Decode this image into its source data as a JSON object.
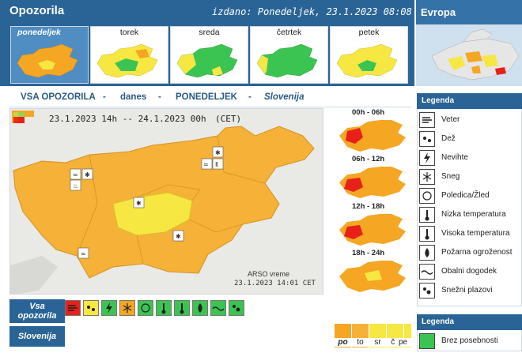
{
  "app": {
    "title": "Opozorila",
    "issued": "izdano: Ponedeljek, 23.1.2023 08:08 CET",
    "europe": "Evropa"
  },
  "days": [
    {
      "label": "ponedeljek",
      "selected": true
    },
    {
      "label": "torek",
      "selected": false
    },
    {
      "label": "sreda",
      "selected": false
    },
    {
      "label": "četrtek",
      "selected": false
    },
    {
      "label": "petek",
      "selected": false
    }
  ],
  "heading": {
    "part1": "VSA OPOZORILA",
    "sep1": "-",
    "part2": "danes",
    "sep2": "-",
    "part3": "PONEDELJEK",
    "sep3": "-",
    "part4": "Slovenija"
  },
  "map": {
    "period": "23.1.2023 14h -- 24.1.2023 00h",
    "tz": "(CET)",
    "source": "ARSO vreme",
    "source_time": "23.1.2023 14:01 CET"
  },
  "slots": [
    "00h - 06h",
    "06h - 12h",
    "12h - 18h",
    "18h - 24h"
  ],
  "bottom": {
    "vsa_label": "Vsa opozorila",
    "slovenija_label": "Slovenija",
    "days": [
      "po",
      "to",
      "sr",
      "če",
      "pe"
    ]
  },
  "legend": {
    "title": "Legenda",
    "items": [
      {
        "label": "Veter",
        "icon": "wind-icon"
      },
      {
        "label": "Dež",
        "icon": "rain-icon"
      },
      {
        "label": "Nevihte",
        "icon": "thunderstorm-icon"
      },
      {
        "label": "Sneg",
        "icon": "snow-icon"
      },
      {
        "label": "Poledica/Žled",
        "icon": "ice-icon"
      },
      {
        "label": "Nizka temperatura",
        "icon": "low-temp-icon"
      },
      {
        "label": "Visoka temperatura",
        "icon": "high-temp-icon"
      },
      {
        "label": "Požarna ogroženost",
        "icon": "fire-icon"
      },
      {
        "label": "Obalni dogodek",
        "icon": "coastal-icon"
      },
      {
        "label": "Snežni plazovi",
        "icon": "avalanche-icon"
      }
    ],
    "title2": "Legenda",
    "item2": "Brez posebnosti"
  },
  "colors": {
    "header": "#2a6496",
    "orange": "#f5a623",
    "yellow": "#f7e743",
    "red": "#e8201a",
    "green": "#3cc452"
  }
}
